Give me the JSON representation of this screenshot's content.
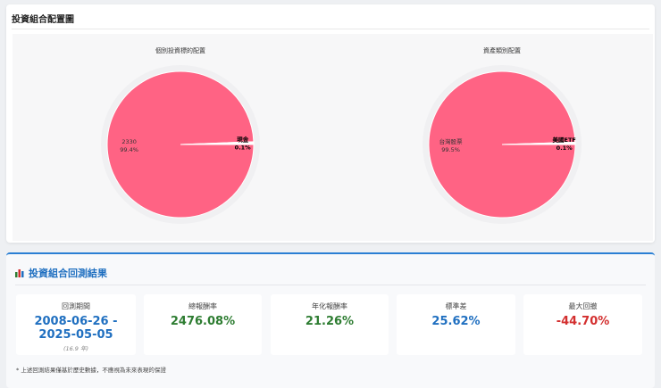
{
  "allocation": {
    "title": "投資組合配置圖",
    "charts": [
      {
        "title": "個別投資標的配置",
        "slices": [
          {
            "label": "2330",
            "pct": "99.4%",
            "value": 99.4
          },
          {
            "label": "現金",
            "pct": "0.1%",
            "value": 0.6
          }
        ]
      },
      {
        "title": "資產類別配置",
        "slices": [
          {
            "label": "台灣股票",
            "pct": "99.5%",
            "value": 99.5
          },
          {
            "label": "美國ETF",
            "pct": "0.1%",
            "value": 0.5
          }
        ]
      }
    ],
    "colors": {
      "main": "#ff6384",
      "minor": "#ffffff"
    }
  },
  "backtest": {
    "title": "投資組合回測結果",
    "metrics": [
      {
        "label": "回測期間",
        "value": "2008-06-26 - 2025-05-05",
        "sub": "(16.9 年)",
        "color": "#1f6fc0"
      },
      {
        "label": "總報酬率",
        "value": "2476.08%",
        "color": "#2e7d32"
      },
      {
        "label": "年化報酬率",
        "value": "21.26%",
        "color": "#2e7d32"
      },
      {
        "label": "標準差",
        "value": "25.62%",
        "color": "#1f6fc0"
      },
      {
        "label": "最大回撤",
        "value": "-44.70%",
        "color": "#d32f2f"
      }
    ],
    "note": "* 上述回測結果僅基於歷史數據，不應視為未來表現的保證"
  }
}
